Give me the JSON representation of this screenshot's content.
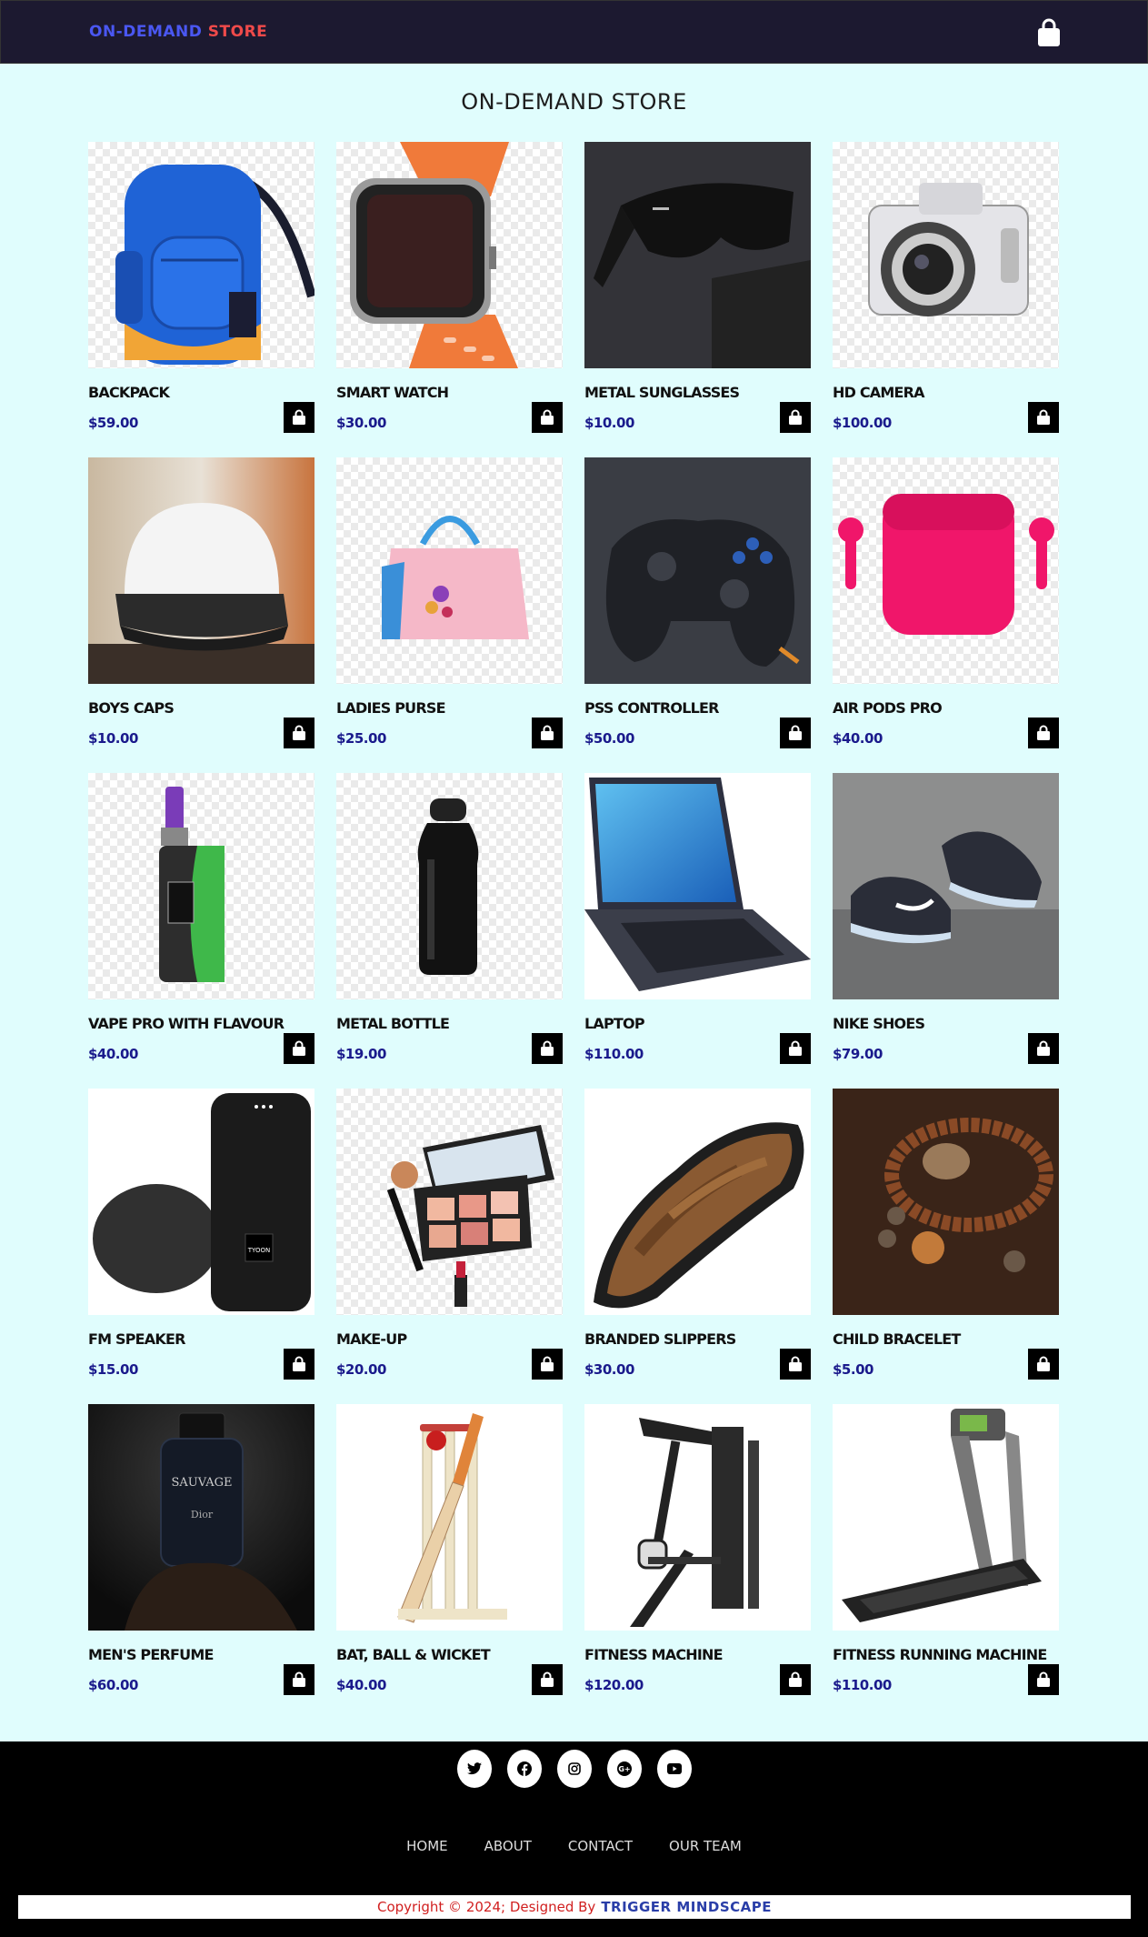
{
  "header": {
    "brand_part1": "ON-DEMAND",
    "brand_part2": "STORE",
    "cart_icon": "shopping-bag-icon",
    "colors": {
      "bg": "#1c1930",
      "brand_blue": "#4a57f2",
      "brand_red": "#f04a4a"
    }
  },
  "page_title": "ON-DEMAND STORE",
  "products": [
    {
      "name": "BACKPACK",
      "price": "$59.00",
      "image": "backpack"
    },
    {
      "name": "SMART WATCH",
      "price": "$30.00",
      "image": "smartwatch"
    },
    {
      "name": "METAL SUNGLASSES",
      "price": "$10.00",
      "image": "sunglasses"
    },
    {
      "name": "HD CAMERA",
      "price": "$100.00",
      "image": "camera"
    },
    {
      "name": "BOYS CAPS",
      "price": "$10.00",
      "image": "cap"
    },
    {
      "name": "LADIES PURSE",
      "price": "$25.00",
      "image": "purse"
    },
    {
      "name": "PSS CONTROLLER",
      "price": "$50.00",
      "image": "controller"
    },
    {
      "name": "AIR PODS PRO",
      "price": "$40.00",
      "image": "airpods"
    },
    {
      "name": "VAPE PRO WITH FLAVOUR",
      "price": "$40.00",
      "image": "vape"
    },
    {
      "name": "METAL BOTTLE",
      "price": "$19.00",
      "image": "bottle"
    },
    {
      "name": "LAPTOP",
      "price": "$110.00",
      "image": "laptop"
    },
    {
      "name": "NIKE SHOES",
      "price": "$79.00",
      "image": "shoes"
    },
    {
      "name": "FM SPEAKER",
      "price": "$15.00",
      "image": "speaker"
    },
    {
      "name": "MAKE-UP",
      "price": "$20.00",
      "image": "makeup"
    },
    {
      "name": "BRANDED SLIPPERS",
      "price": "$30.00",
      "image": "sandal"
    },
    {
      "name": "CHILD BRACELET",
      "price": "$5.00",
      "image": "bracelet"
    },
    {
      "name": "MEN'S PERFUME",
      "price": "$60.00",
      "image": "perfume"
    },
    {
      "name": "BAT, BALL & WICKET",
      "price": "$40.00",
      "image": "cricket"
    },
    {
      "name": "FITNESS MACHINE",
      "price": "$120.00",
      "image": "fitness"
    },
    {
      "name": "FITNESS RUNNING MACHINE",
      "price": "$110.00",
      "image": "treadmill"
    }
  ],
  "product_logos": {
    "speaker": "TYOON",
    "perfume_brand": "SAUVAGE",
    "perfume_maker": "Dior"
  },
  "footer": {
    "social": [
      "twitter-icon",
      "facebook-icon",
      "instagram-icon",
      "google-plus-icon",
      "youtube-icon"
    ],
    "nav": [
      "HOME",
      "ABOUT",
      "CONTACT",
      "OUR TEAM"
    ],
    "copyright": "Copyright © 2024; Designed By",
    "designer": "TRIGGER MINDSCAPE"
  }
}
